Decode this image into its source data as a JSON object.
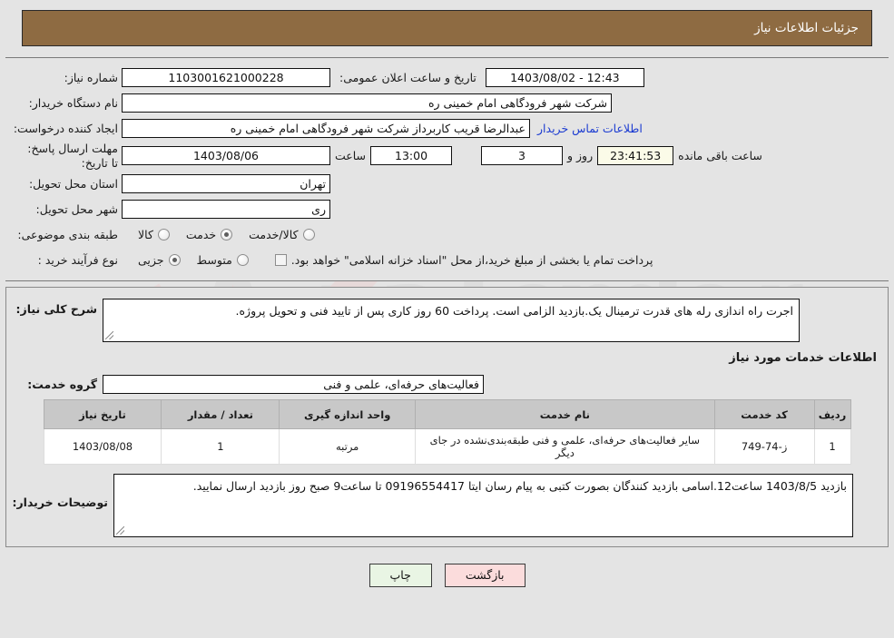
{
  "header": {
    "title": "جزئیات اطلاعات نیاز"
  },
  "form": {
    "need_number_label": "شماره نیاز:",
    "need_number_value": "1103001621000228",
    "announce_label": "تاریخ و ساعت اعلان عمومی:",
    "announce_value": "1403/08/02 - 12:43",
    "buyer_org_label": "نام دستگاه خریدار:",
    "buyer_org_value": "شرکت شهر فرودگاهی امام خمینی  ره",
    "creator_label": "ایجاد کننده درخواست:",
    "creator_value": "عبدالرضا قریب کاربرداز شرکت شهر فرودگاهی امام خمینی  ره",
    "contact_link": "اطلاعات تماس خریدار",
    "deadline_label": "مهلت ارسال پاسخ: تا تاریخ:",
    "deadline_date": "1403/08/06",
    "hour_label": "ساعت",
    "hour_value": "13:00",
    "days_value": "3",
    "days_label": "روز و",
    "countdown_value": "23:41:53",
    "remaining_label": "ساعت باقی مانده",
    "province_label": "استان محل تحویل:",
    "province_value": "تهران",
    "city_label": "شهر محل تحویل:",
    "city_value": "ری",
    "category_label": "طبقه بندی موضوعی:",
    "category_options": [
      "کالا",
      "خدمت",
      "کالا/خدمت"
    ],
    "category_selected": "خدمت",
    "process_label": "نوع فرآیند خرید :",
    "process_options": [
      "جزیی",
      "متوسط"
    ],
    "process_selected": "متوسط",
    "treasury_note": "پرداخت تمام یا بخشی از مبلغ خرید،از محل \"اسناد خزانه اسلامی\" خواهد بود."
  },
  "description": {
    "label": "شرح کلی نیاز:",
    "value": "اجرت راه اندازی رله های قدرت ترمینال یک.بازدید الزامی است. پرداخت 60 روز کاری پس از تایید فنی و تحویل پروژه."
  },
  "services_section": {
    "heading": "اطلاعات خدمات مورد نیاز",
    "group_label": "گروه خدمت:",
    "group_value": "فعالیت‌های حرفه‌ای، علمی و فنی"
  },
  "table": {
    "headers": [
      "ردیف",
      "کد خدمت",
      "نام خدمت",
      "واحد اندازه گیری",
      "تعداد / مقدار",
      "تاریخ نیاز"
    ],
    "rows": [
      {
        "radif": "1",
        "code": "ز-74-749",
        "name": "سایر فعالیت‌های حرفه‌ای، علمی و فنی طبقه‌بندی‌نشده در جای دیگر",
        "unit": "مرتبه",
        "qty": "1",
        "date": "1403/08/08"
      }
    ]
  },
  "notes": {
    "label": "توضیحات خریدار:",
    "value": "بازدید 1403/8/5 ساعت12.اسامی بازدید کنندگان بصورت کتبی به پیام رسان ایتا 09196554417 تا ساعت9 صبح روز بازدید ارسال نمایید."
  },
  "buttons": {
    "print": "چاپ",
    "back": "بازگشت"
  },
  "colors": {
    "header_bg": "#8e6b42",
    "link": "#1a3ad1",
    "countdown_bg": "#fbfbe8",
    "print_bg": "#e9f5e4",
    "back_bg": "#fbdcdc",
    "table_header_bg": "#c8c8c8"
  }
}
